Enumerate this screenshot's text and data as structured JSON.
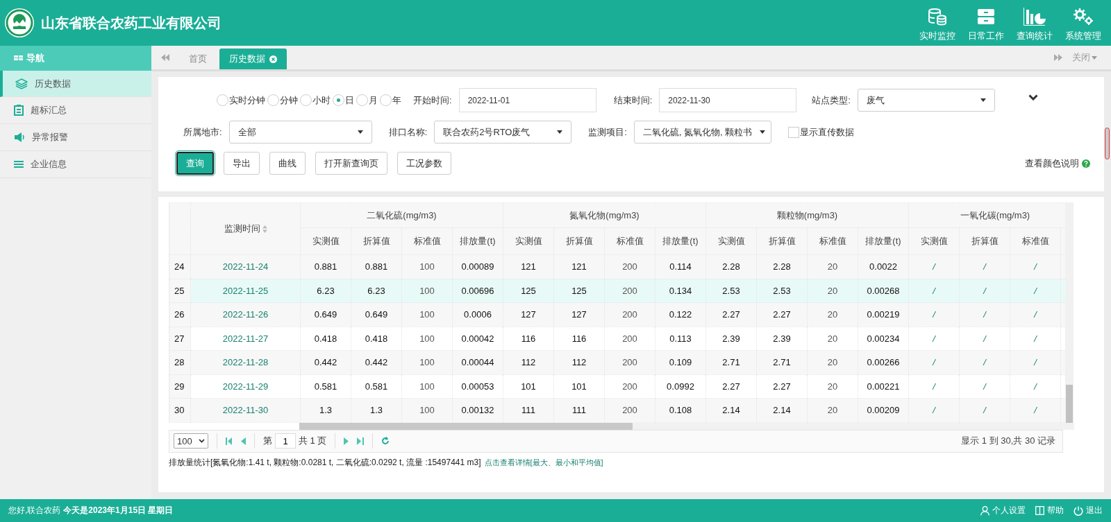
{
  "header": {
    "company": "山东省联合农药工业有限公司",
    "nav": [
      {
        "label": "实时监控",
        "kind": "database"
      },
      {
        "label": "日常工作",
        "kind": "drawer"
      },
      {
        "label": "查询统计",
        "kind": "chart"
      },
      {
        "label": "系统管理",
        "kind": "gears"
      }
    ]
  },
  "sidebar": {
    "title": "导航",
    "items": [
      {
        "label": "历史数据",
        "kind": "layers",
        "selected": true
      },
      {
        "label": "超标汇总",
        "kind": "clipboard",
        "selected": false
      },
      {
        "label": "异常报警",
        "kind": "speaker",
        "selected": false
      },
      {
        "label": "企业信息",
        "kind": "list",
        "selected": false
      }
    ]
  },
  "tabs": [
    {
      "label": "首页",
      "selected": false,
      "closable": false
    },
    {
      "label": "历史数据",
      "selected": true,
      "closable": true
    }
  ],
  "tab_close_menu": "关闭",
  "filters": {
    "intervals": [
      {
        "label": "实时分钟",
        "selected": false
      },
      {
        "label": "分钟",
        "selected": false
      },
      {
        "label": "小时",
        "selected": false
      },
      {
        "label": "日",
        "selected": true
      },
      {
        "label": "月",
        "selected": false
      },
      {
        "label": "年",
        "selected": false
      }
    ],
    "start_time": {
      "label": "开始时间:",
      "value": "2022-11-01"
    },
    "end_time": {
      "label": "结束时间:",
      "value": "2022-11-30"
    },
    "site_type": {
      "label": "站点类型:",
      "value": "废气"
    },
    "city": {
      "label": "所属地市:",
      "value": "全部"
    },
    "outlet": {
      "label": "排口名称:",
      "value": "联合农药2号RTO废气"
    },
    "pollutants": {
      "label": "监测项目:",
      "value": "二氧化硫, 氮氧化物, 颗粒书"
    },
    "show_direct": {
      "label": "显示直传数据",
      "checked": false
    }
  },
  "buttons": [
    {
      "label": "查询",
      "primary": true
    },
    {
      "label": "导出",
      "primary": false
    },
    {
      "label": "曲线",
      "primary": false
    },
    {
      "label": "打开新查询页",
      "primary": false
    },
    {
      "label": "工况参数",
      "primary": false
    }
  ],
  "color_legend_link": "查看颜色说明",
  "table": {
    "time_column": "监测时间",
    "groups": [
      {
        "title": "二氧化硫(mg/m3)",
        "subcolumns": [
          "实测值",
          "折算值",
          "标准值",
          "排放量(t)"
        ]
      },
      {
        "title": "氮氧化物(mg/m3)",
        "subcolumns": [
          "实测值",
          "折算值",
          "标准值",
          "排放量(t)"
        ]
      },
      {
        "title": "颗粒物(mg/m3)",
        "subcolumns": [
          "实测值",
          "折算值",
          "标准值",
          "排放量(t)"
        ]
      },
      {
        "title": "一氧化碳(mg/m3)",
        "subcolumns": [
          "实测值",
          "折算值",
          "标准值"
        ]
      }
    ],
    "rows": [
      {
        "index": "24",
        "time": "2022-11-24",
        "selected": false,
        "values": [
          "0.881",
          "0.881",
          "100",
          "0.00089",
          "121",
          "121",
          "200",
          "0.114",
          "2.28",
          "2.28",
          "20",
          "0.0022",
          "/",
          "/",
          "/"
        ]
      },
      {
        "index": "25",
        "time": "2022-11-25",
        "selected": true,
        "values": [
          "6.23",
          "6.23",
          "100",
          "0.00696",
          "125",
          "125",
          "200",
          "0.134",
          "2.53",
          "2.53",
          "20",
          "0.00268",
          "/",
          "/",
          "/"
        ]
      },
      {
        "index": "26",
        "time": "2022-11-26",
        "selected": false,
        "values": [
          "0.649",
          "0.649",
          "100",
          "0.0006",
          "127",
          "127",
          "200",
          "0.122",
          "2.27",
          "2.27",
          "20",
          "0.00219",
          "/",
          "/",
          "/"
        ]
      },
      {
        "index": "27",
        "time": "2022-11-27",
        "selected": false,
        "values": [
          "0.418",
          "0.418",
          "100",
          "0.00042",
          "116",
          "116",
          "200",
          "0.113",
          "2.39",
          "2.39",
          "20",
          "0.00234",
          "/",
          "/",
          "/"
        ]
      },
      {
        "index": "28",
        "time": "2022-11-28",
        "selected": false,
        "values": [
          "0.442",
          "0.442",
          "100",
          "0.00044",
          "112",
          "112",
          "200",
          "0.109",
          "2.71",
          "2.71",
          "20",
          "0.00266",
          "/",
          "/",
          "/"
        ]
      },
      {
        "index": "29",
        "time": "2022-11-29",
        "selected": false,
        "values": [
          "0.581",
          "0.581",
          "100",
          "0.00053",
          "101",
          "101",
          "200",
          "0.0992",
          "2.27",
          "2.27",
          "20",
          "0.00221",
          "/",
          "/",
          "/"
        ]
      },
      {
        "index": "30",
        "time": "2022-11-30",
        "selected": false,
        "values": [
          "1.3",
          "1.3",
          "100",
          "0.00132",
          "111",
          "111",
          "200",
          "0.108",
          "2.14",
          "2.14",
          "20",
          "0.00209",
          "/",
          "/",
          "/"
        ]
      }
    ]
  },
  "pagination": {
    "page_size": "100",
    "page_prefix": "第",
    "page": "1",
    "page_suffix": "共 1 页",
    "summary": "显示 1 到 30,共 30 记录"
  },
  "stats": {
    "text": "排放量统计[氮氧化物:1.41 t, 颗粒物:0.0281 t, 二氧化硫:0.0292 t, 流量 :15497441 m3]",
    "link": "点击查看详情[最大、最小和平均值]"
  },
  "status_bar": {
    "greeting": "您好,联合农药",
    "date": "今天是2023年1月15日 星期日",
    "links": [
      {
        "label": "个人设置",
        "kind": "user"
      },
      {
        "label": "帮助",
        "kind": "book"
      },
      {
        "label": "退出",
        "kind": "power"
      }
    ]
  }
}
